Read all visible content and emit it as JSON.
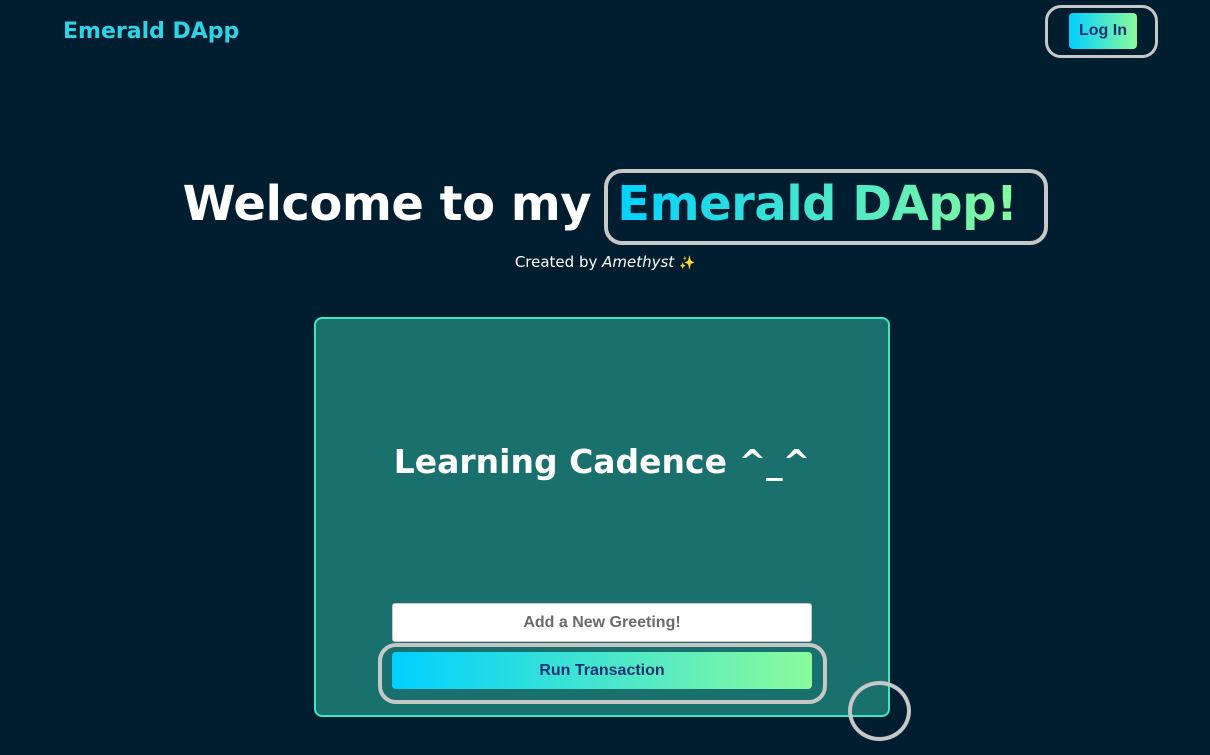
{
  "header": {
    "brand": "Emerald DApp",
    "login_label": "Log In"
  },
  "hero": {
    "title_prefix": "Welcome to my ",
    "title_accent": "Emerald DApp!",
    "created_by_prefix": "Created by ",
    "created_by_author": "Amethyst",
    "created_by_icon": "sparkles-icon"
  },
  "card": {
    "title": "Learning Cadence ^_^",
    "greeting_placeholder": "Add a New Greeting!",
    "run_label": "Run Transaction"
  },
  "colors": {
    "background": "#011e30",
    "brand_text": "#2ed3e6",
    "gradient_start": "#00d0ff",
    "gradient_end": "#8bfb9c",
    "card_bg": "#1a706d",
    "card_border": "#3ee6c2",
    "button_text": "#1e3373",
    "highlight_ring": "#c7c7c7"
  }
}
